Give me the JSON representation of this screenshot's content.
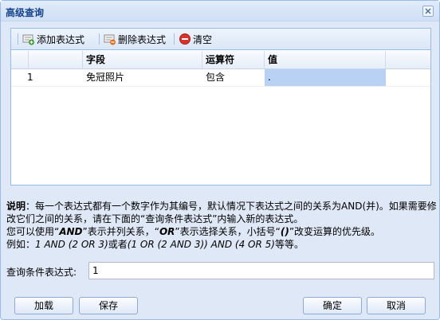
{
  "window": {
    "title": "高级查询"
  },
  "toolbar": {
    "add_label": "添加表达式",
    "delete_label": "删除表达式",
    "clear_label": "清空"
  },
  "grid": {
    "columns": [
      "字段",
      "运算符",
      "值"
    ],
    "rows": [
      {
        "index": "1",
        "field": "免冠照片",
        "operator": "包含",
        "value": "."
      }
    ]
  },
  "help": {
    "bold_prefix": "说明",
    "line1_rest": "：每一个表达式都有一个数字作为其编号，默认情况下表达式之间的关系为AND(并)。如果需要修改它们之间的关系，请在下面的“查询条件表达式”内输入新的表达式。",
    "line2_a": "您可以使用“",
    "line2_and": "AND",
    "line2_b": "”表示并列关系，“",
    "line2_or": "OR",
    "line2_c": "”表示选择关系，小括号“",
    "line2_paren": "()",
    "line2_d": "”改变运算的优先级。",
    "line3_a": "例如：",
    "line3_ex1": "1 AND (2 OR 3)",
    "line3_b": "或者",
    "line3_ex2": "(1 OR (2 AND 3)) AND (4 OR 5)",
    "line3_c": "等等。"
  },
  "expression": {
    "label": "查询条件表达式:",
    "value": "1"
  },
  "buttons": {
    "load": "加载",
    "save": "保存",
    "confirm": "确定",
    "cancel": "取消"
  },
  "icons": {
    "add": "add-expression-icon",
    "delete": "delete-expression-icon",
    "clear": "clear-icon",
    "close": "close-icon"
  },
  "colors": {
    "title_text": "#15428b",
    "border": "#99bbe8",
    "background": "#dfe8f6",
    "edit_cell": "#b9d2f3",
    "clear_icon": "#d9342b",
    "add_badge": "#3a9a2e",
    "delete_badge": "#e0701f"
  }
}
